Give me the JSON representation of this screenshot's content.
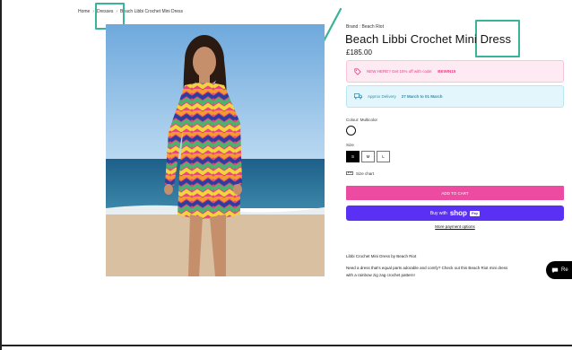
{
  "breadcrumb": {
    "home": "Home",
    "separator": "›",
    "category": "Dresses",
    "current": "Beach Libbi Crochet Mini Dress"
  },
  "product": {
    "brand": "Brand : Beach Riot",
    "title": "Beach Libbi Crochet Mini Dress",
    "price": "£185.00"
  },
  "promo": {
    "icon": "tag-icon",
    "text": "NEW HERE? Get 15% off with code:",
    "code": "BEWIN15"
  },
  "delivery": {
    "icon": "truck-icon",
    "text": "Approx Delivery",
    "dates": "27 March to 01 March"
  },
  "colour": {
    "label": "Colour: Multicolor"
  },
  "size": {
    "label": "Size",
    "options": [
      "S",
      "M",
      "L"
    ],
    "selected": "S",
    "chart_label": "Size chart"
  },
  "actions": {
    "add_to_cart": "ADD TO CART",
    "buy_with": "Buy with",
    "shop": "shop",
    "pay": "Pay",
    "more_payment": "More payment options"
  },
  "description": {
    "title": "Libbi Crochet Mini Dress by Beach Riot",
    "line1": "Need a dress that's equal parts adorable and comfy? Check out this Beach Riot mini dress",
    "line2": "with a rainbow zig zag crochet pattern!"
  },
  "chat": {
    "icon": "chat-icon",
    "label": "Re"
  },
  "colors": {
    "accent_pink": "#ec4ba1",
    "shop_pay": "#5a31f4",
    "highlight": "#3bb29a"
  }
}
